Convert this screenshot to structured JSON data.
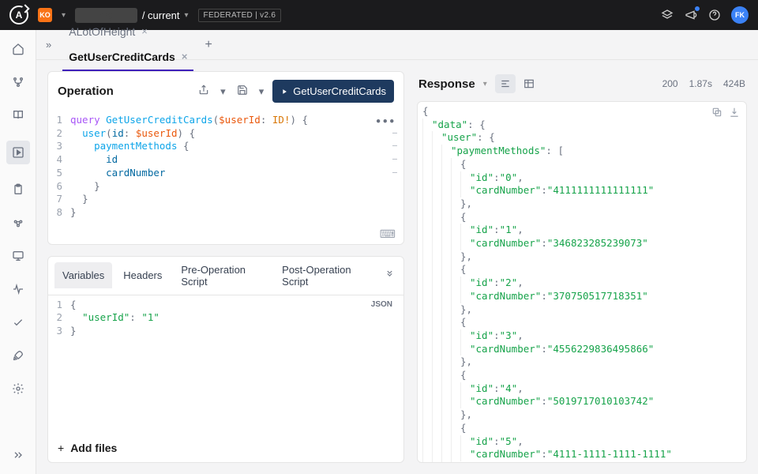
{
  "topbar": {
    "org_badge": "KO",
    "bc_current": "/ current",
    "federated": "FEDERATED",
    "version": "v2.6",
    "avatar": "FK"
  },
  "tabs": [
    {
      "label": "ALotOfHeight",
      "active": false
    },
    {
      "label": "GetUserCreditCards",
      "active": true
    }
  ],
  "operation": {
    "title": "Operation",
    "run_label": "GetUserCreditCards",
    "query_lines": [
      {
        "n": 1,
        "tokens": [
          [
            "kw",
            "query "
          ],
          [
            "fn",
            "GetUserCreditCards"
          ],
          [
            "punc",
            "("
          ],
          [
            "var",
            "$userId"
          ],
          [
            "punc",
            ": "
          ],
          [
            "type",
            "ID!"
          ],
          [
            "punc",
            ") {"
          ]
        ],
        "fold": false
      },
      {
        "n": 2,
        "tokens": [
          [
            "",
            "  "
          ],
          [
            "fn",
            "user"
          ],
          [
            "punc",
            "("
          ],
          [
            "key",
            "id"
          ],
          [
            "punc",
            ": "
          ],
          [
            "var",
            "$userId"
          ],
          [
            "punc",
            ") {"
          ]
        ],
        "fold": true
      },
      {
        "n": 3,
        "tokens": [
          [
            "",
            "    "
          ],
          [
            "fn",
            "paymentMethods"
          ],
          [
            "punc",
            " {"
          ]
        ],
        "fold": true
      },
      {
        "n": 4,
        "tokens": [
          [
            "",
            "      "
          ],
          [
            "key",
            "id"
          ]
        ],
        "fold": true
      },
      {
        "n": 5,
        "tokens": [
          [
            "",
            "      "
          ],
          [
            "key",
            "cardNumber"
          ]
        ],
        "fold": true
      },
      {
        "n": 6,
        "tokens": [
          [
            "",
            "    "
          ],
          [
            "punc",
            "}"
          ]
        ],
        "fold": false
      },
      {
        "n": 7,
        "tokens": [
          [
            "",
            "  "
          ],
          [
            "punc",
            "}"
          ]
        ],
        "fold": false
      },
      {
        "n": 8,
        "tokens": [
          [
            "punc",
            "}"
          ]
        ],
        "fold": false
      }
    ]
  },
  "vars_panel": {
    "tabs": [
      "Variables",
      "Headers",
      "Pre-Operation Script",
      "Post-Operation Script"
    ],
    "active": 0,
    "json_badge": "JSON",
    "lines": [
      {
        "n": 1,
        "tokens": [
          [
            "punc",
            "{"
          ]
        ]
      },
      {
        "n": 2,
        "tokens": [
          [
            "",
            "  "
          ],
          [
            "str",
            "\"userId\""
          ],
          [
            "punc",
            ": "
          ],
          [
            "str",
            "\"1\""
          ]
        ]
      },
      {
        "n": 3,
        "tokens": [
          [
            "punc",
            "}"
          ]
        ]
      }
    ],
    "add_files": "Add files"
  },
  "response": {
    "title": "Response",
    "status": "200",
    "time": "1.87s",
    "size": "424B",
    "body": {
      "data": {
        "user": {
          "paymentMethods": [
            {
              "id": "0",
              "cardNumber": "4111111111111111"
            },
            {
              "id": "1",
              "cardNumber": "346823285239073"
            },
            {
              "id": "2",
              "cardNumber": "370750517718351"
            },
            {
              "id": "3",
              "cardNumber": "4556229836495866"
            },
            {
              "id": "4",
              "cardNumber": "5019717010103742"
            },
            {
              "id": "5",
              "cardNumber": "4111-1111-1111-1111"
            }
          ]
        }
      }
    }
  }
}
